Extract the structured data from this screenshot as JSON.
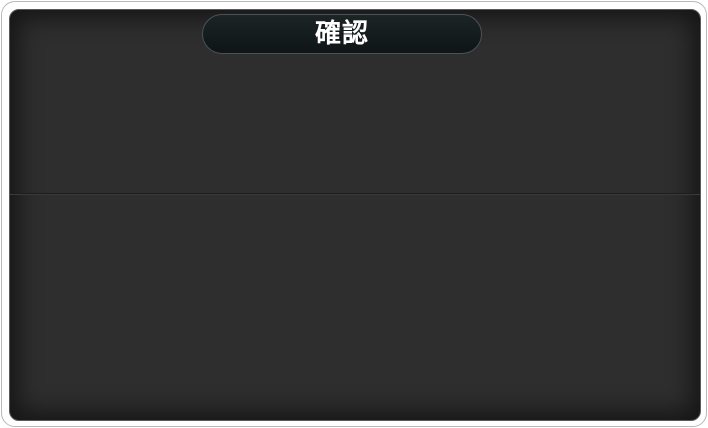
{
  "dialog": {
    "title": "確認"
  }
}
